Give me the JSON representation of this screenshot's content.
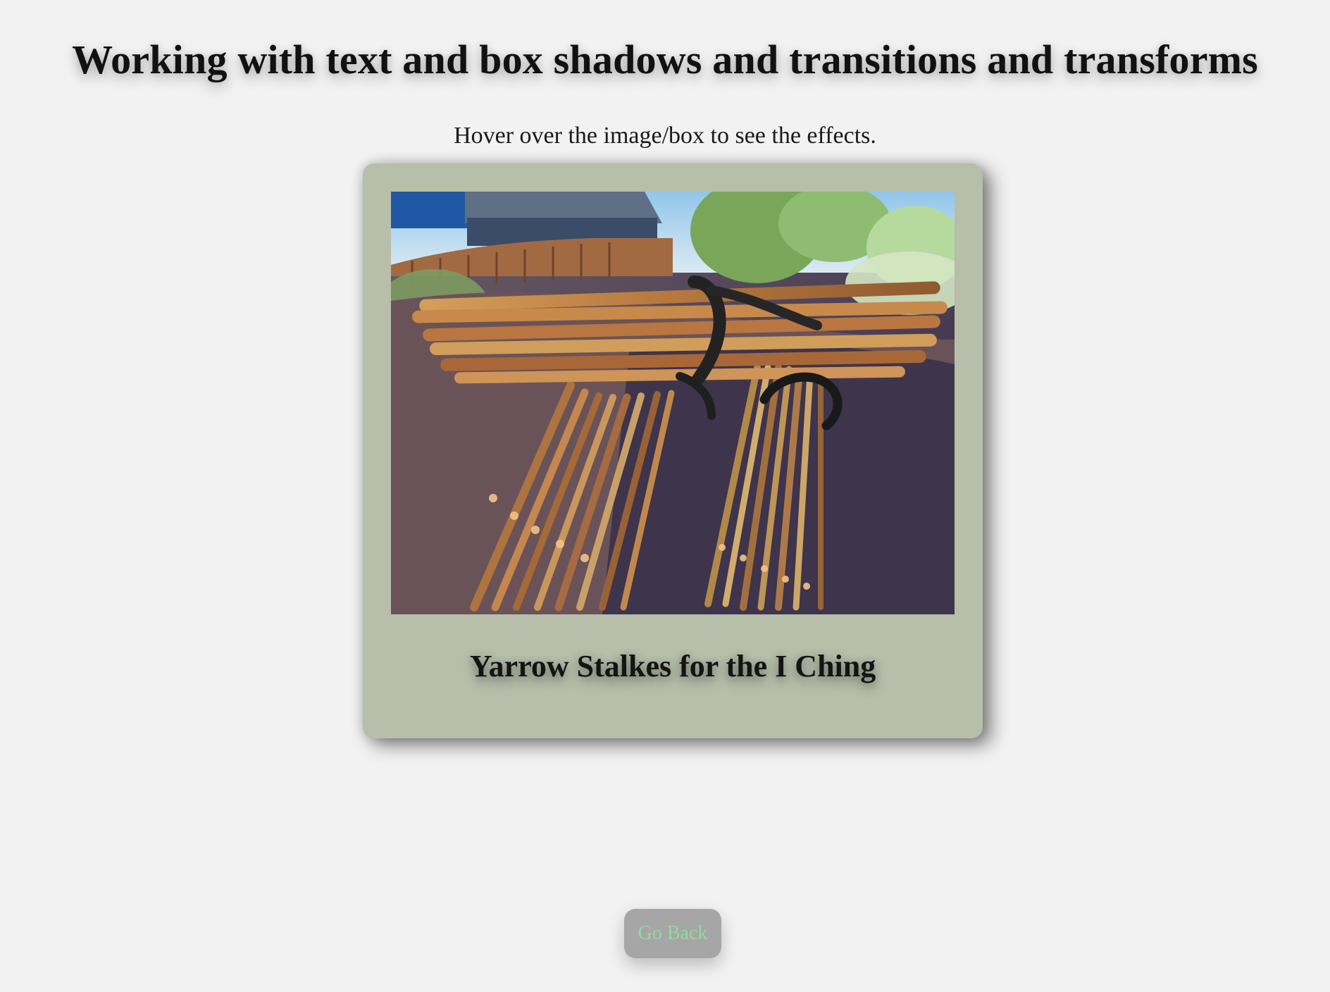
{
  "header": {
    "title": "Working with text and box shadows and transitions and transforms",
    "subtitle": "Hover over the image/box to see the effects."
  },
  "card": {
    "image_alt": "Yarrow stalks tied in bundles",
    "caption": "Yarrow Stalkes for the I Ching",
    "background_color": "#b7beaa"
  },
  "actions": {
    "go_back_label": "Go Back"
  },
  "colors": {
    "page_background": "#f2f2f2",
    "button_background": "#a6a6a6",
    "button_text": "#98d79f"
  }
}
